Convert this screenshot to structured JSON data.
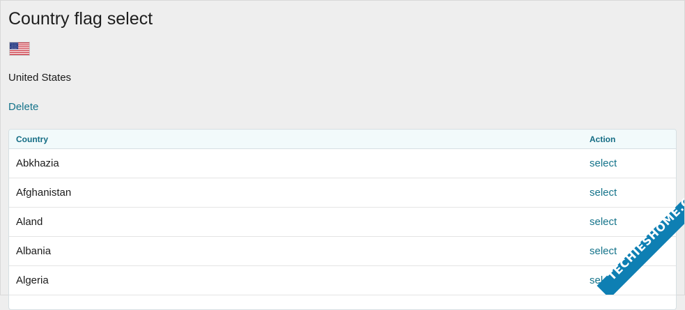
{
  "page": {
    "title": "Country flag select"
  },
  "selection": {
    "flag_icon": "us-flag-icon",
    "country": "United States",
    "delete_label": "Delete"
  },
  "table": {
    "headers": {
      "country": "Country",
      "action": "Action"
    },
    "rows": [
      {
        "country": "Abkhazia",
        "action": "select"
      },
      {
        "country": "Afghanistan",
        "action": "select"
      },
      {
        "country": "Aland",
        "action": "select"
      },
      {
        "country": "Albania",
        "action": "select"
      },
      {
        "country": "Algeria",
        "action": "select"
      }
    ]
  },
  "watermark": {
    "text": "TECHIESHOME.COM"
  },
  "colors": {
    "link": "#14738a",
    "header_text": "#136c84",
    "background": "#eeeeee"
  }
}
